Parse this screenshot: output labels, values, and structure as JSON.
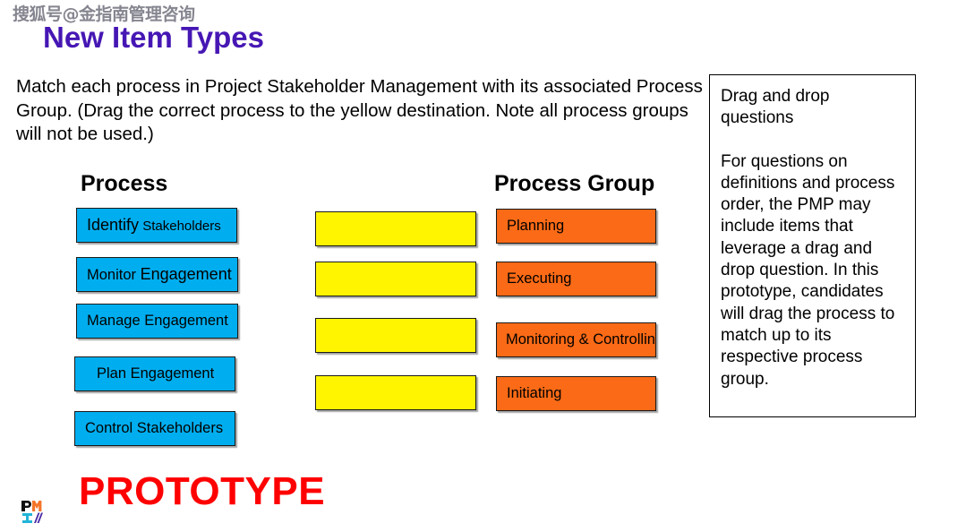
{
  "watermark": {
    "text": "搜狐号@金指南管理咨询"
  },
  "title": "New Item Types",
  "instructions": "Match each process in Project Stakeholder Management with its associated Process Group. (Drag the correct process to the yellow destination. Note all process groups will not be used.)",
  "note_box": {
    "heading": "Drag and drop questions",
    "body": "For questions on definitions and process order, the PMP may include items that leverage a drag and drop question. In this prototype, candidates will drag the process to match up to its respective process group."
  },
  "columns": {
    "process_heading": "Process",
    "process_group_heading": "Process Group"
  },
  "process_items": [
    {
      "label_a": "Identify",
      "label_b": "Stakeholders"
    },
    {
      "label_a": "Monitor",
      "label_b": "Engagement"
    },
    {
      "label_a": "Manage",
      "label_b": "Engagement"
    },
    {
      "label_a": "Plan",
      "label_b": "Engagement"
    },
    {
      "label_a": "Control",
      "label_b": "Stakeholders"
    }
  ],
  "drop_zones": [
    {
      "label": ""
    },
    {
      "label": ""
    },
    {
      "label": ""
    },
    {
      "label": ""
    }
  ],
  "process_groups": [
    {
      "label": "Planning"
    },
    {
      "label": "Executing"
    },
    {
      "label": "Monitoring & Controlling"
    },
    {
      "label": "Initiating"
    }
  ],
  "footer": {
    "prototype_label": "PROTOTYPE",
    "logo_text": "PMI"
  },
  "colors": {
    "title": "#4617B4",
    "process_card": "#00AEEF",
    "process_group_card": "#FB6A16",
    "drop_zone": "#FFF500",
    "prototype": "#FF0000",
    "border": "#1A1A1A"
  }
}
